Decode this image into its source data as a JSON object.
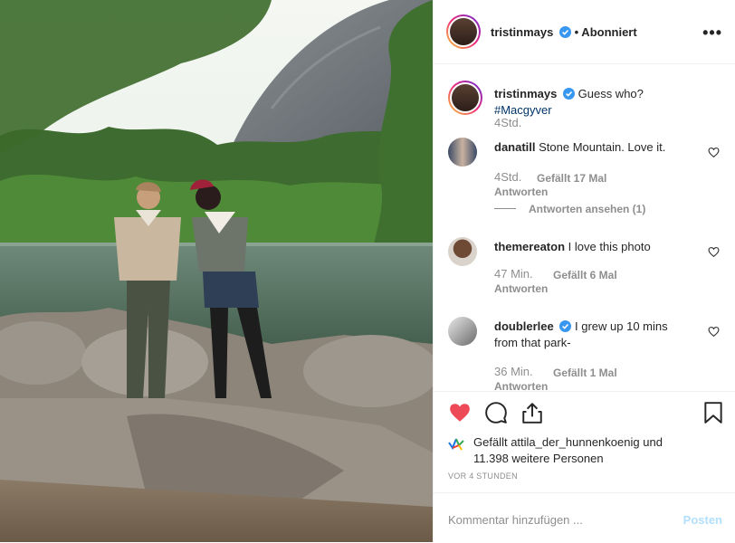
{
  "header": {
    "username": "tristinmays",
    "follow_status": "• Abonniert",
    "more_icon": "more-horizontal-icon"
  },
  "caption": {
    "username": "tristinmays",
    "text": "Guess who?",
    "hashtag": "#Macgyver",
    "time": "4Std."
  },
  "comments": [
    {
      "username": "danatill",
      "text": "Stone Mountain. Love it.",
      "time": "4Std.",
      "likes": "Gefällt 17 Mal",
      "reply": "Antworten",
      "view_replies": "Antworten ansehen (1)"
    },
    {
      "username": "themereaton",
      "text": "I love this photo",
      "time": "47 Min.",
      "likes": "Gefällt 6 Mal",
      "reply": "Antworten"
    },
    {
      "username": "doublerlee",
      "text": "I grew up 10 mins from that park-",
      "time": "36 Min.",
      "likes": "Gefällt 1 Mal",
      "reply": "Antworten"
    }
  ],
  "actions": {
    "like_icon": "heart-filled-icon",
    "comment_icon": "comment-bubble-icon",
    "share_icon": "share-icon",
    "save_icon": "bookmark-icon"
  },
  "likes": {
    "prefix": "Gefällt",
    "user": "attila_der_hunnenkoenig",
    "connector": "und",
    "others": "11.398 weitere Personen"
  },
  "timestamp": "VOR 4 STUNDEN",
  "comment_box": {
    "placeholder": "Kommentar hinzufügen ...",
    "post_label": "Posten"
  },
  "colors": {
    "like_red": "#ed4956",
    "link_blue": "#003569",
    "verified_blue": "#3897f0",
    "post_disabled": "#b2dffc"
  }
}
